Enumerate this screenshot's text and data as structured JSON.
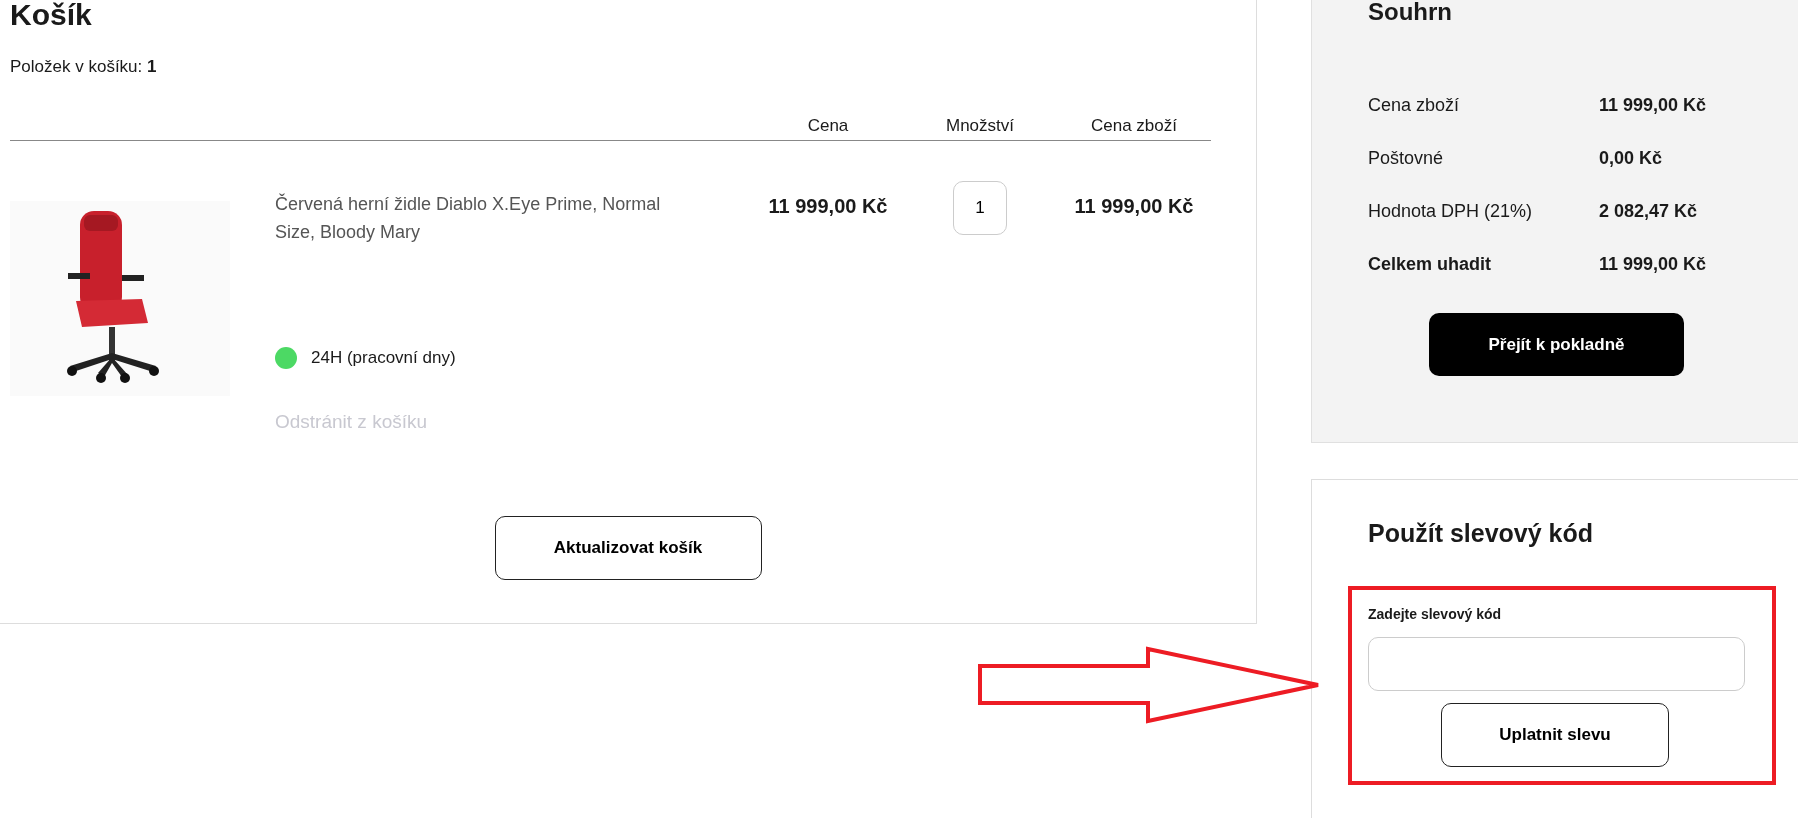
{
  "cart": {
    "title": "Košík",
    "item_count": "Položek v košíku: **1**",
    "columns": [
      "Cena",
      "Množství",
      "Cena zboží"
    ],
    "items": [
      {
        "name": "Červená herní židle Diablo X.Eye Prime, Normal Size, Bloody Mary",
        "price": "11 999,00 Kč",
        "quantity": "1",
        "total": "11 999,00 Kč",
        "availability": {
          "text": "24H (pracovní dny)",
          "color": "#4cd964"
        },
        "remove_link": "Odstránit z košíku"
      }
    ],
    "update_button": "Aktualizovat košík"
  },
  "summary": {
    "title": "Souhrn",
    "rows": [
      {
        "kind": "normal",
        "label": "Cena zboží",
        "value": "11 999,00 Kč"
      },
      {
        "kind": "normal",
        "label": "Poštovné",
        "value": "0,00 Kč"
      },
      {
        "kind": "normal",
        "label": "Hodnota DPH (21%)",
        "value": "2 082,47 Kč"
      },
      {
        "kind": "total",
        "label": "Celkem uhadit",
        "value": "11 999,00 Kč"
      }
    ],
    "checkout_button": "Přejít k pokladně"
  },
  "discount": {
    "title": "Použít slevový kód",
    "field_label": "Zadejte slevový kód",
    "apply_button": "Uplatnit slevu",
    "highlighted": true
  },
  "annotations": [
    {
      "kind": "arrow"
    }
  ]
}
